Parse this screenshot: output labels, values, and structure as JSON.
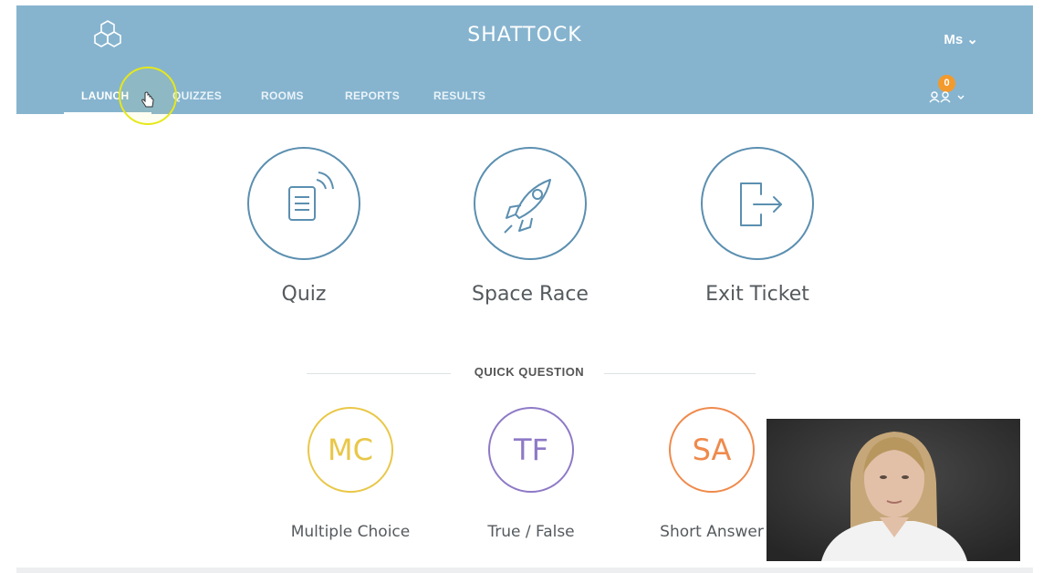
{
  "header": {
    "brand": "SHATTOCK",
    "user_label": "Ms",
    "student_count": "0",
    "tabs": [
      {
        "label": "LAUNCH",
        "active": true
      },
      {
        "label": "QUIZZES",
        "active": false
      },
      {
        "label": "ROOMS",
        "active": false
      },
      {
        "label": "REPORTS",
        "active": false
      },
      {
        "label": "RESULTS",
        "active": false
      }
    ]
  },
  "activities": [
    {
      "label": "Quiz",
      "icon": "quiz-icon"
    },
    {
      "label": "Space Race",
      "icon": "rocket-icon"
    },
    {
      "label": "Exit Ticket",
      "icon": "exit-icon"
    }
  ],
  "quick_question": {
    "title": "QUICK QUESTION",
    "items": [
      {
        "abbr": "MC",
        "label": "Multiple Choice",
        "color": "#e9c747"
      },
      {
        "abbr": "TF",
        "label": "True / False",
        "color": "#8e79c6"
      },
      {
        "abbr": "SA",
        "label": "Short Answer",
        "color": "#ef8a4c"
      }
    ]
  },
  "colors": {
    "header_bg": "#86b4cf",
    "icon_stroke": "#5b8fb0",
    "badge": "#f39a2d"
  }
}
